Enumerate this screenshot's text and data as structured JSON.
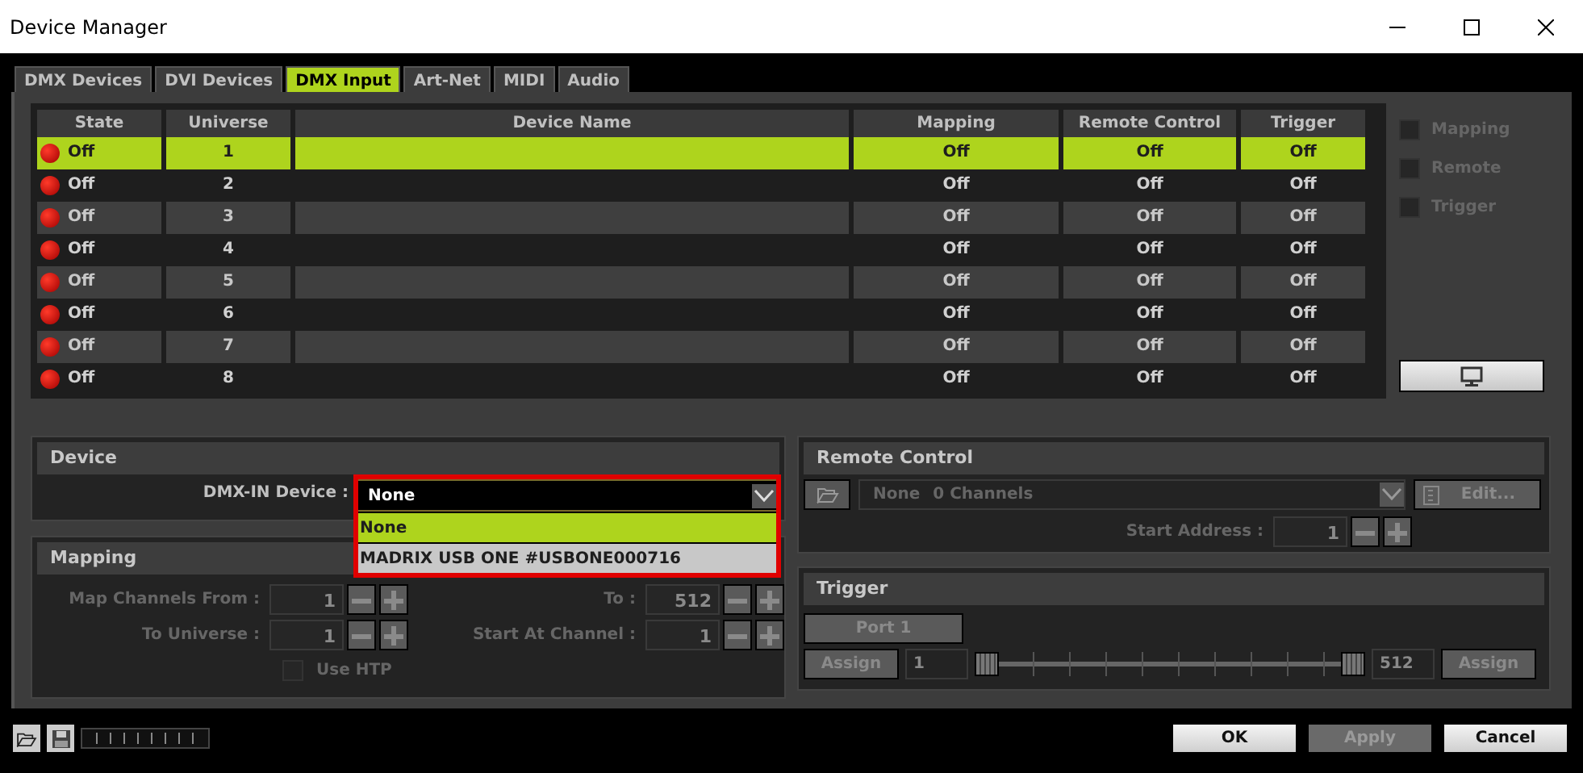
{
  "window": {
    "title": "Device Manager"
  },
  "tabs": [
    {
      "label": "DMX Devices",
      "selected": false
    },
    {
      "label": "DVI Devices",
      "selected": false
    },
    {
      "label": "DMX Input",
      "selected": true
    },
    {
      "label": "Art-Net",
      "selected": false
    },
    {
      "label": "MIDI",
      "selected": false
    },
    {
      "label": "Audio",
      "selected": false
    }
  ],
  "table": {
    "columns": [
      "State",
      "Universe",
      "Device Name",
      "Mapping",
      "Remote Control",
      "Trigger"
    ],
    "rows": [
      {
        "state": "Off",
        "universe": "1",
        "mapping": "Off",
        "remote_control": "Off",
        "trigger": "Off",
        "selected": true
      },
      {
        "state": "Off",
        "universe": "2",
        "mapping": "Off",
        "remote_control": "Off",
        "trigger": "Off",
        "selected": false
      },
      {
        "state": "Off",
        "universe": "3",
        "mapping": "Off",
        "remote_control": "Off",
        "trigger": "Off",
        "selected": false
      },
      {
        "state": "Off",
        "universe": "4",
        "mapping": "Off",
        "remote_control": "Off",
        "trigger": "Off",
        "selected": false
      },
      {
        "state": "Off",
        "universe": "5",
        "mapping": "Off",
        "remote_control": "Off",
        "trigger": "Off",
        "selected": false
      },
      {
        "state": "Off",
        "universe": "6",
        "mapping": "Off",
        "remote_control": "Off",
        "trigger": "Off",
        "selected": false
      },
      {
        "state": "Off",
        "universe": "7",
        "mapping": "Off",
        "remote_control": "Off",
        "trigger": "Off",
        "selected": false
      },
      {
        "state": "Off",
        "universe": "8",
        "mapping": "Off",
        "remote_control": "Off",
        "trigger": "Off",
        "selected": false
      }
    ]
  },
  "filters": [
    {
      "label": "Mapping",
      "checked": false
    },
    {
      "label": "Remote",
      "checked": false
    },
    {
      "label": "Trigger",
      "checked": false
    }
  ],
  "device": {
    "title": "Device",
    "label": "DMX-IN Device :",
    "value": "None",
    "options": [
      {
        "label": "None",
        "selected": true
      },
      {
        "label": "MADRIX USB ONE #USBONE000716",
        "selected": false
      }
    ]
  },
  "mapping": {
    "title": "Mapping",
    "fields": [
      {
        "label": "Map Channels From :",
        "value": "1"
      },
      {
        "label": "To :",
        "value": "512"
      },
      {
        "label": "To Universe :",
        "value": "1"
      },
      {
        "label": "Start At Channel :",
        "value": "1"
      }
    ],
    "use_htp": {
      "label": "Use HTP",
      "checked": false
    }
  },
  "remote_control": {
    "title": "Remote Control",
    "preset": "None",
    "channels": "0 Channels",
    "edit": "Edit...",
    "start_label": "Start Address :",
    "start_value": "1"
  },
  "trigger": {
    "title": "Trigger",
    "port": "Port 1",
    "assign_left": "Assign",
    "low_value": "1",
    "low": {
      "level": 0
    },
    "high": {
      "level": 1
    },
    "high_value": "512",
    "assign_right": "Assign"
  },
  "buttons": [
    {
      "label": "OK",
      "disabled": false
    },
    {
      "label": "Apply",
      "disabled": true
    },
    {
      "label": "Cancel",
      "disabled": false
    }
  ]
}
